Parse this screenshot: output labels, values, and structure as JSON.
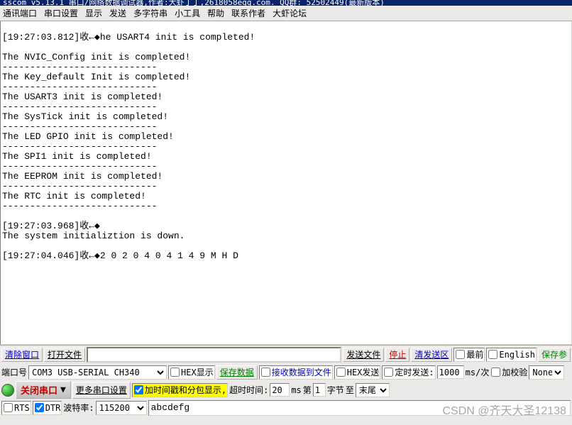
{
  "titlebar": "sscom v5.13.1 串口/网络数据调试器,作者:大虾丁丁,2618058eqq.com. QQ群: 52502449(最新版本)",
  "menu": [
    "通讯端口",
    "串口设置",
    "显示",
    "发送",
    "多字符串",
    "小工具",
    "帮助",
    "联系作者",
    "大虾论坛"
  ],
  "log": {
    "l1": "[19:27:03.812]收←◆he USART4 init is completed!",
    "l2": "The NVIC_Config init is completed!",
    "l3": "----------------------------",
    "l4": "The Key_default Init is completed!",
    "l5": "----------------------------",
    "l6": "The USART3 init is completed!",
    "l7": "----------------------------",
    "l8": "The SysTick init is completed!",
    "l9": "----------------------------",
    "l10": "The LED GPIO init is completed!",
    "l11": "----------------------------",
    "l12": "The SPI1 init is completed!",
    "l13": "----------------------------",
    "l14": "The EEPROM init is completed!",
    "l15": "----------------------------",
    "l16": "The RTC init is completed!",
    "l17": "----------------------------",
    "blank": "",
    "l18": "[19:27:03.968]收←◆",
    "l19": "The system initializtion is down.",
    "l20": "[19:27:04.046]收←◆2 0 2 0 4 0 4 1 4 9 M H D "
  },
  "row1": {
    "clear": "清除窗口",
    "open": "打开文件",
    "sendfile": "发送文件",
    "stop": "停止",
    "clearsend": "清发送区",
    "front": "最前",
    "english": "English",
    "savepar": "保存参"
  },
  "row2": {
    "portlabel": "端口号",
    "port": "COM3 USB-SERIAL CH340",
    "hexshow": "HEX显示",
    "savedata": "保存数据",
    "recvfile": "接收数据到文件",
    "hexsend": "HEX发送",
    "timedsend": "定时发送:",
    "interval": "1000",
    "unit": "ms/次",
    "checksum_lbl": "加校验",
    "checksum_val": "None"
  },
  "row3": {
    "closeport": "关闭串口",
    "moresettings": "更多串口设置",
    "timestamp": "加时间戳和分包显示,",
    "timeoutlabel": "超时时间:",
    "timeout": "20",
    "ms": "ms",
    "di": "第",
    "byte_no": "1",
    "zijie": "字节",
    "zhi": "至",
    "tail": "末尾"
  },
  "row4": {
    "rts": "RTS",
    "dtr": "DTR",
    "baudlabel": "波特率:",
    "baud": "115200",
    "send_text": "abcdefg"
  },
  "watermark": "CSDN @齐天大圣12138"
}
